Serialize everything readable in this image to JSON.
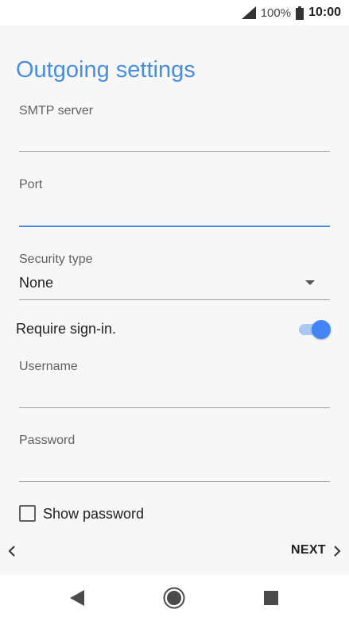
{
  "status_bar": {
    "icons": [
      "signal-icon",
      "battery-icon"
    ],
    "battery_percent": "100%",
    "time": "10:00"
  },
  "page": {
    "title": "Outgoing settings"
  },
  "form": {
    "smtp_server": {
      "label": "SMTP server",
      "value": ""
    },
    "port": {
      "label": "Port",
      "value": ""
    },
    "security_type": {
      "label": "Security type",
      "value": "None"
    },
    "require_signin": {
      "label": "Require sign-in.",
      "enabled": true
    },
    "username": {
      "label": "Username",
      "value": ""
    },
    "password": {
      "label": "Password",
      "value": ""
    },
    "show_password": {
      "label": "Show password",
      "checked": false
    }
  },
  "navigation": {
    "next_label": "NEXT",
    "prev_icon": "chevron-left-icon",
    "next_icon": "chevron-right-icon"
  },
  "system_nav": {
    "icons": [
      "back-icon",
      "home-icon",
      "recents-icon"
    ]
  },
  "colors": {
    "accent": "#4a8de0",
    "toggle_on": "#4285f4"
  }
}
